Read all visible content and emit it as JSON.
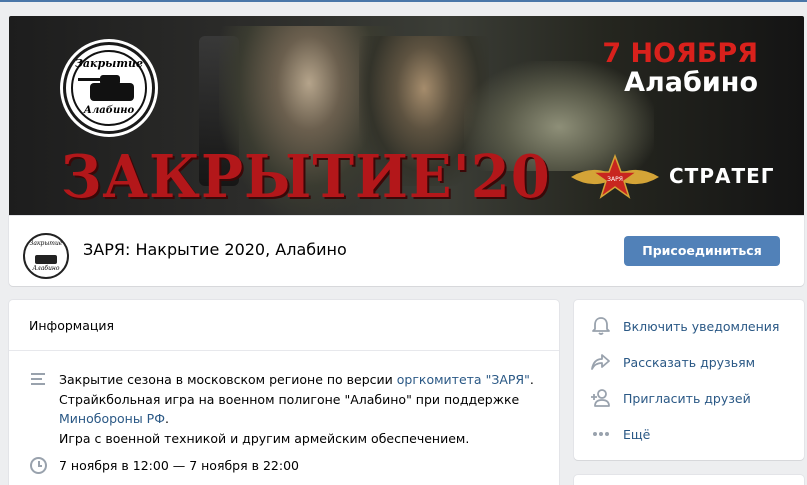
{
  "cover": {
    "logo_top": "Закрытие",
    "logo_bottom": "Алабино",
    "date_line1": "7 НОЯБРЯ",
    "date_line2": "Алабино",
    "title": "ЗАКРЫТИЕ'20",
    "emblem_text": "ЗАРЯ",
    "sponsor": "СТРАТЕГ"
  },
  "header": {
    "group_name": "ЗАРЯ: Накрытие 2020, Алабино",
    "join_label": "Присоединиться"
  },
  "info": {
    "title": "Информация",
    "desc_part1": "Закрытие сезона в московском регионе по версии ",
    "desc_link1": "оргкомитета \"ЗАРЯ\"",
    "desc_part2": ".",
    "desc_line2": "Страйкбольная игра на военном полигоне \"Алабино\" при поддержке",
    "desc_link2": "Минобороны РФ",
    "desc_part3": ".",
    "desc_line4": "Игра с военной техникой и другим армейским обеспечением.",
    "time": "7 ноября в 12:00 — 7 ноября в 22:00"
  },
  "actions": {
    "notify": "Включить уведомления",
    "share": "Рассказать друзьям",
    "invite": "Пригласить друзей",
    "more": "Ещё"
  },
  "colors": {
    "accent": "#4a76a8",
    "button": "#5181b8",
    "link": "#2a5885",
    "icon": "#99a2ad",
    "cover_red": "#b3171a"
  }
}
